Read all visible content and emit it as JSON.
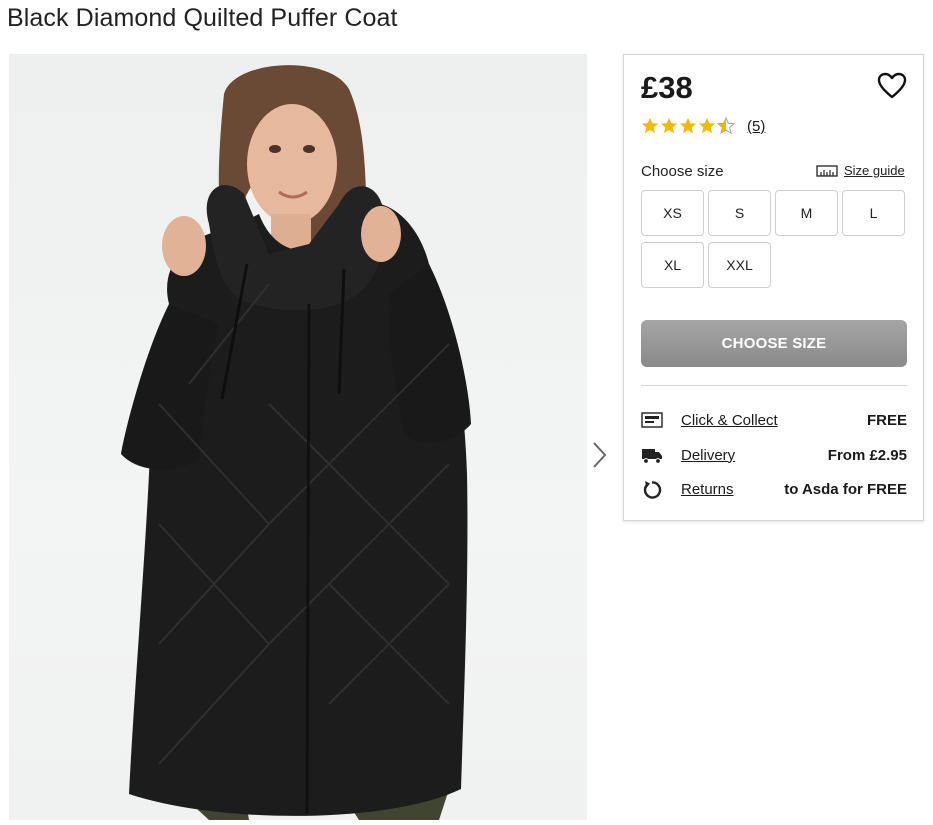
{
  "product": {
    "title": "Black Diamond Quilted Puffer Coat",
    "price": "£38",
    "rating": 4.5,
    "rating_max": 5,
    "review_count": "(5)"
  },
  "sizes": {
    "label": "Choose size",
    "guide_label": "Size guide",
    "options": [
      "XS",
      "S",
      "M",
      "L",
      "XL",
      "XXL"
    ]
  },
  "cta": {
    "label": "CHOOSE SIZE"
  },
  "services": [
    {
      "icon": "click-collect-icon",
      "label": "Click & Collect",
      "value": "FREE"
    },
    {
      "icon": "delivery-truck-icon",
      "label": "Delivery",
      "value": "From £2.95"
    },
    {
      "icon": "returns-icon",
      "label": "Returns",
      "value": "to Asda for FREE"
    }
  ],
  "colors": {
    "star": "#f5b800",
    "cta_bg": "#999999",
    "coat": "#1c1c1c"
  },
  "icons": {
    "wishlist": "heart-icon",
    "next": "chevron-right-icon",
    "size_guide": "ruler-icon"
  }
}
